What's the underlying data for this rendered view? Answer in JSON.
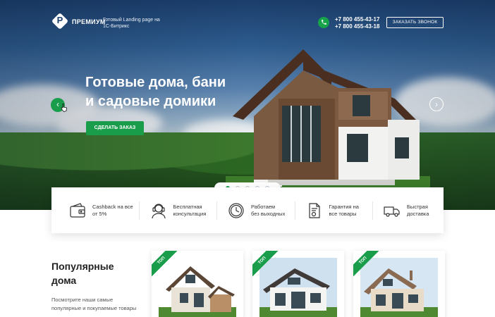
{
  "header": {
    "brand": "ПРЕМИУМ",
    "tagline": "Готовый Landing page на 1С-Битрикс",
    "phones": [
      "+7 800 455-43-17",
      "+7 800 455-43-18"
    ],
    "callback_label": "ЗАКАЗАТЬ ЗВОНОК",
    "logo_letter": "P"
  },
  "hero": {
    "headline_line1": "Готовые дома, бани",
    "headline_line2": "и садовые домики",
    "cta_label": "СДЕЛАТЬ ЗАКАЗ",
    "prev_arrow": "‹",
    "next_arrow": "›",
    "slide_count": 5,
    "active_slide": 1
  },
  "features": [
    {
      "icon": "wallet-icon",
      "line1": "Cashback на все",
      "line2": "от 5%"
    },
    {
      "icon": "support-agent-icon",
      "line1": "Бесплатная",
      "line2": "консультация"
    },
    {
      "icon": "clock-icon",
      "line1": "Работаем",
      "line2": "без выходных"
    },
    {
      "icon": "certificate-icon",
      "line1": "Гарантия на",
      "line2": "все товары"
    },
    {
      "icon": "delivery-truck-icon",
      "line1": "Быстрая",
      "line2": "доставка"
    }
  ],
  "popular": {
    "title_line1": "Популярные",
    "title_line2": "дома",
    "description": "Посмотрите наши самые популярные и покупаемые товары"
  },
  "cards": [
    {
      "badge": "ТОП"
    },
    {
      "badge": "ТОП"
    },
    {
      "badge": "ТОП"
    }
  ],
  "colors": {
    "accent": "#1a9d4b",
    "sky_top": "#1c3f6e"
  }
}
